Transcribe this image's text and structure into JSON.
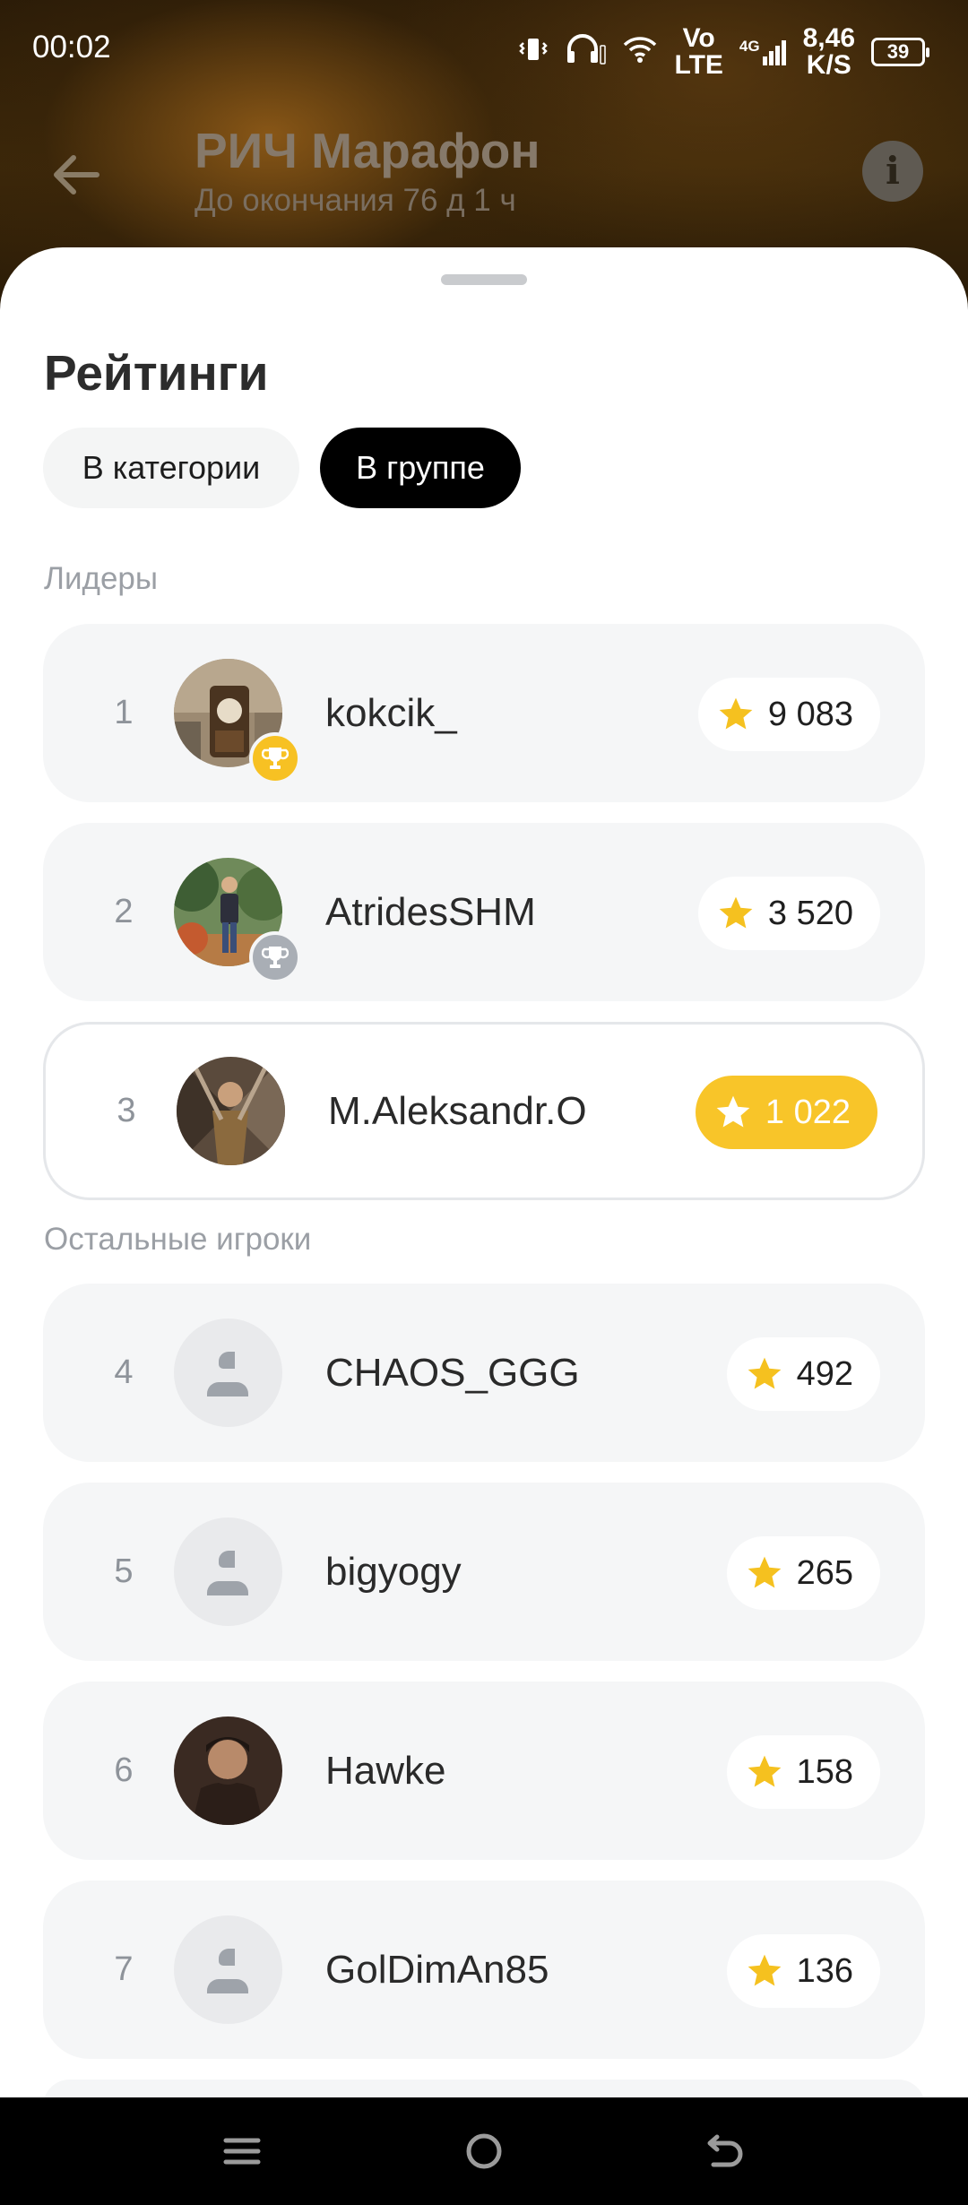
{
  "status_bar": {
    "time": "00:02",
    "network_top": "Vo",
    "network_bottom": "LTE",
    "network_gen": "4G",
    "speed_value": "8,46",
    "speed_unit": "K/S",
    "battery": "39"
  },
  "header": {
    "title": "РИЧ Марафон",
    "subtitle": "До окончания 76 д 1 ч"
  },
  "sheet": {
    "title": "Рейтинги",
    "tabs": [
      {
        "label": "В категории",
        "active": false
      },
      {
        "label": "В группе",
        "active": true
      }
    ],
    "leaders_label": "Лидеры",
    "others_label": "Остальные игроки"
  },
  "leaders": [
    {
      "rank": "1",
      "name": "kokcik_",
      "score": "9 083",
      "trophy": "gold"
    },
    {
      "rank": "2",
      "name": "AtridesSHM",
      "score": "3 520",
      "trophy": "silver"
    },
    {
      "rank": "3",
      "name": "M.Aleksandr.O",
      "score": "1 022",
      "current_user": true
    }
  ],
  "others": [
    {
      "rank": "4",
      "name": "CHAOS_GGG",
      "score": "492",
      "avatar": "placeholder"
    },
    {
      "rank": "5",
      "name": "bigyogy",
      "score": "265",
      "avatar": "placeholder"
    },
    {
      "rank": "6",
      "name": "Hawke",
      "score": "158",
      "avatar": "photo"
    },
    {
      "rank": "7",
      "name": "GolDimAn85",
      "score": "136",
      "avatar": "placeholder"
    }
  ],
  "colors": {
    "accent_yellow": "#f8c529",
    "tab_active_bg": "#000000",
    "row_bg": "#f5f6f7"
  },
  "icons": [
    "back-arrow-icon",
    "info-icon",
    "star-icon",
    "trophy-icon",
    "user-placeholder-icon",
    "menu-icon",
    "home-icon",
    "back-icon"
  ]
}
